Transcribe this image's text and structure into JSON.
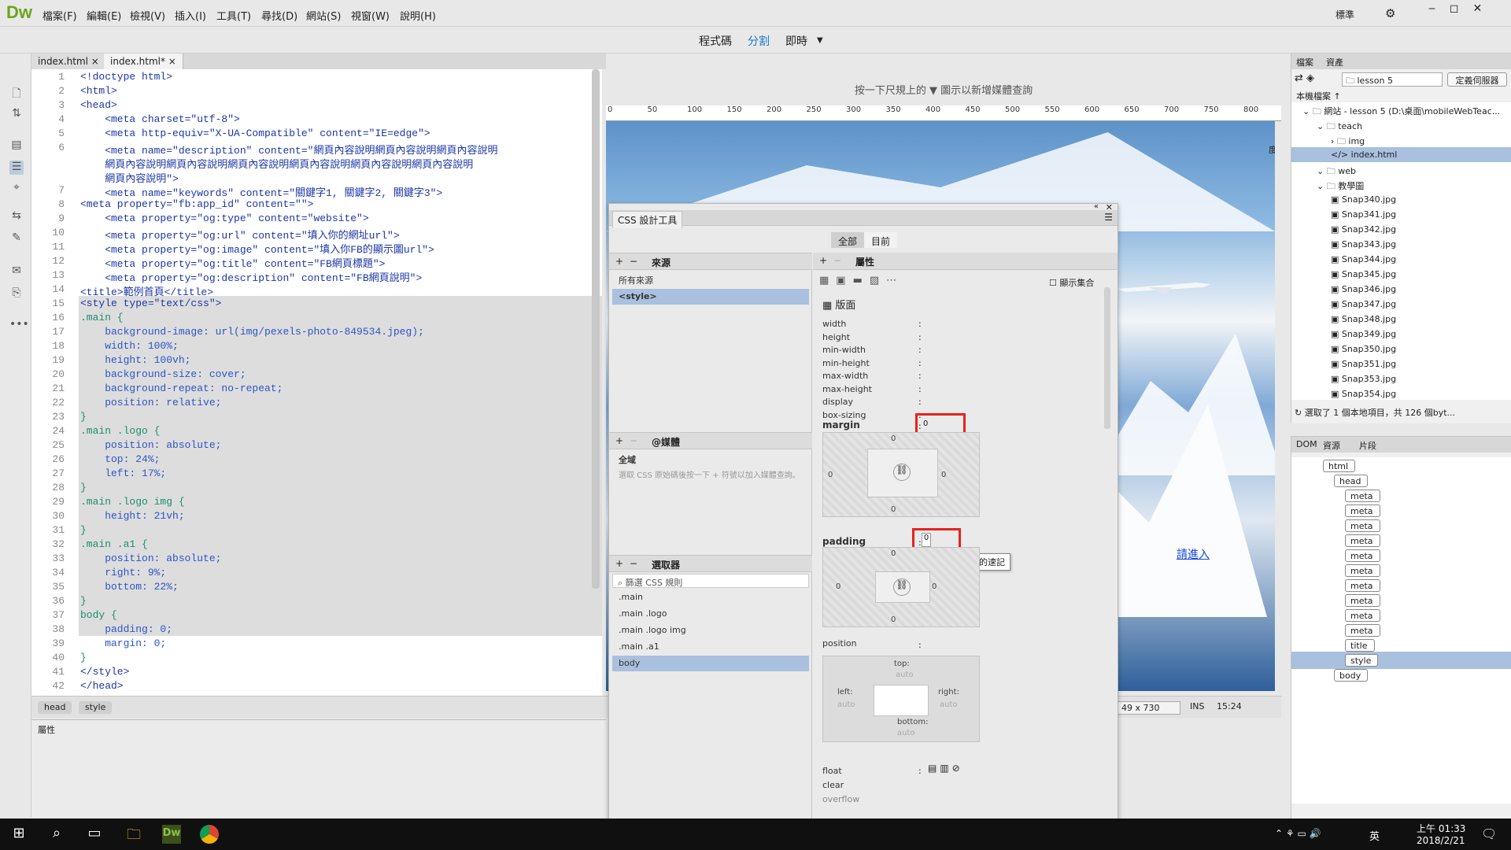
{
  "app": {
    "logo": "Dw"
  },
  "menu": {
    "items": [
      "檔案(F)",
      "編輯(E)",
      "檢視(V)",
      "插入(I)",
      "工具(T)",
      "尋找(D)",
      "網站(S)",
      "視窗(W)",
      "說明(H)"
    ],
    "workspace": "標準",
    "gear": "⚙"
  },
  "view": {
    "code": "程式碼",
    "split": "分割",
    "live": "即時"
  },
  "tabs": [
    "index.html",
    "index.html*"
  ],
  "code": {
    "lines": [
      "<!doctype html>",
      "<html>",
      "<head>",
      "    <meta charset=\"utf-8\">",
      "    <meta http-equiv=\"X-UA-Compatible\" content=\"IE=edge\">",
      "    <meta name=\"description\" content=\"網頁內容說明網頁內容說明網頁內容說明",
      "    網頁內容說明網頁內容說明網頁內容說明網頁內容說明網頁內容說明網頁內容說明",
      "    網頁內容說明\">",
      "    <meta name=\"keywords\" content=\"關鍵字1, 關鍵字2, 關鍵字3\">",
      "<meta property=\"fb:app_id\" content=\"\">",
      "    <meta property=\"og:type\" content=\"website\">",
      "    <meta property=\"og:url\" content=\"填入你的網址url\">",
      "    <meta property=\"og:image\" content=\"填入你FB的顯示圖url\">",
      "    <meta property=\"og:title\" content=\"FB網頁標題\">",
      "    <meta property=\"og:description\" content=\"FB網頁說明\">",
      "<title>範例首頁</title>",
      "<style type=\"text/css\">",
      ".main {",
      "    background-image: url(img/pexels-photo-849534.jpeg);",
      "    width: 100%;",
      "    height: 100vh;",
      "    background-size: cover;",
      "    background-repeat: no-repeat;",
      "    position: relative;",
      "}",
      ".main .logo {",
      "    position: absolute;",
      "    top: 24%;",
      "    left: 17%;",
      "}",
      ".main .logo img {",
      "    height: 21vh;",
      "}",
      ".main .a1 {",
      "    position: absolute;",
      "    right: 9%;",
      "    bottom: 22%;",
      "}",
      "body {",
      "    padding: 0;",
      "    margin: 0;",
      "}",
      "</style>",
      "</head>"
    ],
    "numbers": [
      "1",
      "2",
      "3",
      "4",
      "5",
      "6",
      "",
      "",
      "7",
      "8",
      "9",
      "10",
      "11",
      "12",
      "13",
      "14",
      "15",
      "16",
      "17",
      "18",
      "19",
      "20",
      "21",
      "22",
      "23",
      "24",
      "25",
      "26",
      "27",
      "28",
      "29",
      "30",
      "31",
      "32",
      "33",
      "34",
      "35",
      "36",
      "37",
      "38",
      "39",
      "40",
      "41",
      "42"
    ]
  },
  "tagbar": {
    "crumbs": [
      "head",
      "style"
    ]
  },
  "props": {
    "title": "屬性"
  },
  "live": {
    "ruler_hint": "按一下尺規上的 ▼ 圖示以新增媒體查詢",
    "ruler_ticks": [
      "0",
      "50",
      "100",
      "150",
      "200",
      "250",
      "300",
      "350",
      "400",
      "450",
      "500",
      "550",
      "600",
      "650",
      "700",
      "750",
      "800"
    ],
    "link": "請進入",
    "edge_text": "度",
    "size": "49 x 730",
    "ins": "INS",
    "pos": "15:24"
  },
  "css": {
    "title": "CSS 設計工具",
    "all": "全部",
    "current": "目前",
    "sources": {
      "label": "來源",
      "items": [
        "所有來源",
        "<style>"
      ]
    },
    "media": {
      "label": "@媒體",
      "global": "全域",
      "hint": "選取 CSS 原始碼後按一下 + 符號以加入媒體查詢。"
    },
    "selectors": {
      "label": "選取器",
      "filter": "篩選 CSS 規則",
      "items": [
        ".main",
        ".main .logo",
        ".main .logo img",
        ".main .a1",
        "body"
      ]
    },
    "properties": {
      "label": "屬性",
      "show_set": "顯示集合",
      "layout": "版面",
      "names": [
        "width",
        "height",
        "min-width",
        "min-height",
        "max-width",
        "max-height",
        "display",
        "box-sizing"
      ],
      "margin": {
        "label": "margin",
        "value": "0",
        "top": "0",
        "right": "0",
        "bottom": "0",
        "left": "0"
      },
      "padding": {
        "label": "padding",
        "value": "0",
        "top": "0",
        "right": "0",
        "bottom": "0",
        "left": "0"
      },
      "tooltip": "設定間距的速記",
      "position": {
        "label": "position",
        "top": "top:",
        "right": "right:",
        "bottom": "bottom:",
        "left": "left:",
        "auto": "auto"
      },
      "float": "float",
      "clear": "clear",
      "overflow": "overflow"
    }
  },
  "files": {
    "tab1": "檔案",
    "tab2": "資產",
    "site": "lesson 5",
    "define_server": "定義伺服器",
    "local": "本機檔案 ↑",
    "rows": [
      {
        "t": "網站 - lesson 5 (D:\\桌面\\mobileWebTeac...",
        "d": 0
      },
      {
        "t": "teach",
        "d": 1
      },
      {
        "t": "img",
        "d": 2
      },
      {
        "t": "index.html",
        "d": 2
      },
      {
        "t": "web",
        "d": 1
      },
      {
        "t": "教學圖",
        "d": 1
      },
      {
        "t": "Snap340.jpg",
        "d": 2
      },
      {
        "t": "Snap341.jpg",
        "d": 2
      },
      {
        "t": "Snap342.jpg",
        "d": 2
      },
      {
        "t": "Snap343.jpg",
        "d": 2
      },
      {
        "t": "Snap344.jpg",
        "d": 2
      },
      {
        "t": "Snap345.jpg",
        "d": 2
      },
      {
        "t": "Snap346.jpg",
        "d": 2
      },
      {
        "t": "Snap347.jpg",
        "d": 2
      },
      {
        "t": "Snap348.jpg",
        "d": 2
      },
      {
        "t": "Snap349.jpg",
        "d": 2
      },
      {
        "t": "Snap350.jpg",
        "d": 2
      },
      {
        "t": "Snap351.jpg",
        "d": 2
      },
      {
        "t": "Snap353.jpg",
        "d": 2
      },
      {
        "t": "Snap354.jpg",
        "d": 2
      }
    ],
    "status": "選取了 1 個本地項目，共 126 個byt..."
  },
  "dom": {
    "tabs": [
      "DOM",
      "資源",
      "片段"
    ],
    "nodes": [
      {
        "t": "html",
        "d": 0
      },
      {
        "t": "head",
        "d": 1
      },
      {
        "t": "meta",
        "d": 2
      },
      {
        "t": "meta",
        "d": 2
      },
      {
        "t": "meta",
        "d": 2
      },
      {
        "t": "meta",
        "d": 2
      },
      {
        "t": "meta",
        "d": 2
      },
      {
        "t": "meta",
        "d": 2
      },
      {
        "t": "meta",
        "d": 2
      },
      {
        "t": "meta",
        "d": 2
      },
      {
        "t": "meta",
        "d": 2
      },
      {
        "t": "meta",
        "d": 2
      },
      {
        "t": "title",
        "d": 2
      },
      {
        "t": "style",
        "d": 2
      },
      {
        "t": "body",
        "d": 1
      }
    ]
  },
  "taskbar": {
    "ime": "英",
    "time": "上午 01:33",
    "date": "2018/2/21"
  }
}
